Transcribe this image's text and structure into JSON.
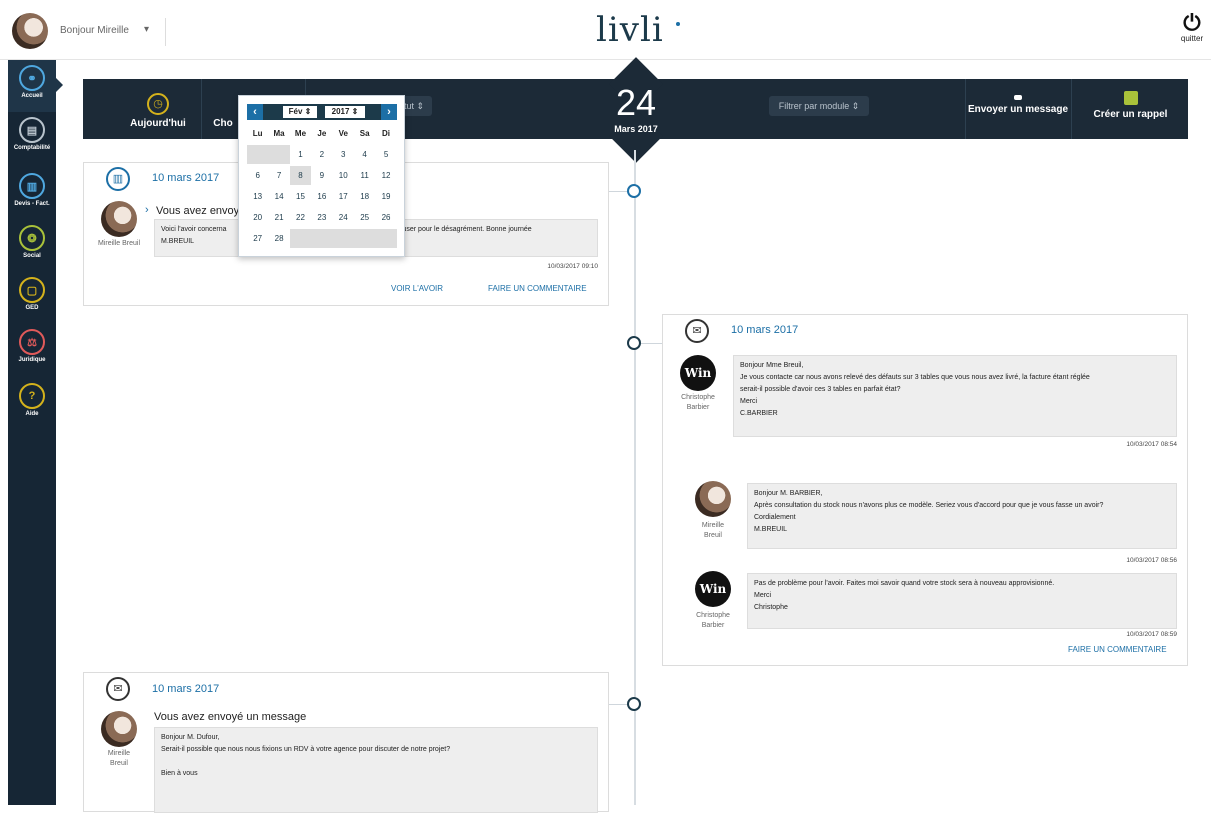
{
  "header": {
    "greeting": "Bonjour Mireille",
    "caret": "▾",
    "logo": "livli",
    "quit_icon": "⏻",
    "quit_label": "quitter"
  },
  "sidebar": {
    "items": [
      {
        "label": "Accueil",
        "icon": "home-network-icon",
        "glyph": "⚭",
        "color": "#4fa8e0",
        "active": true
      },
      {
        "label": "Comptabilité",
        "icon": "ledger-icon",
        "glyph": "▤",
        "color": "#b8c3cc"
      },
      {
        "label": "Devis - Fact.",
        "icon": "invoice-icon",
        "glyph": "▥",
        "color": "#4fa8e0"
      },
      {
        "label": "Social",
        "icon": "people-icon",
        "glyph": "❂",
        "color": "#a9c23a"
      },
      {
        "label": "GED",
        "icon": "documents-icon",
        "glyph": "▢",
        "color": "#d4b21c"
      },
      {
        "label": "Juridique",
        "icon": "legal-icon",
        "glyph": "⚖",
        "color": "#e05a5a"
      },
      {
        "label": "Aide",
        "icon": "help-icon",
        "glyph": "?",
        "color": "#d4b21c"
      }
    ]
  },
  "toolbar": {
    "today": "Aujourd'hui",
    "choose": "Cho",
    "status_filter": "tut ⇕",
    "module_filter": "Filtrer par module ⇕",
    "send_message": "Envoyer un message",
    "create_reminder": "Créer un rappel",
    "date_day": "24",
    "date_month": "Mars 2017"
  },
  "calendar": {
    "prev": "‹",
    "next": "›",
    "month": "Fév ⇕",
    "year": "2017 ⇕",
    "weekdays": [
      "Lu",
      "Ma",
      "Me",
      "Je",
      "Ve",
      "Sa",
      "Di"
    ],
    "weeks": [
      [
        "",
        "",
        "1",
        "2",
        "3",
        "4",
        "5"
      ],
      [
        "6",
        "7",
        "8",
        "9",
        "10",
        "11",
        "12"
      ],
      [
        "13",
        "14",
        "15",
        "16",
        "17",
        "18",
        "19"
      ],
      [
        "20",
        "21",
        "22",
        "23",
        "24",
        "25",
        "26"
      ],
      [
        "27",
        "28",
        "",
        "",
        "",
        "",
        ""
      ]
    ],
    "selected": "8"
  },
  "card1": {
    "date": "10 mars 2017",
    "title": "Vous avez envoyé",
    "author": "Mireille Breuil",
    "message_left": "Voici l'avoir concerna",
    "message_right": "cuser pour le désagrément. Bonne journée",
    "signature": "M.BREUIL",
    "time": "10/03/2017 09:10",
    "link_view": "VOIR L'AVOIR",
    "link_comment": "FAIRE UN COMMENTAIRE"
  },
  "card2": {
    "date": "10 mars 2017",
    "messages": [
      {
        "author_first": "Christophe",
        "author_last": "Barbier",
        "lines": [
          "Bonjour Mme Breuil,",
          "Je vous contacte car nous avons relevé des défauts sur 3 tables que vous nous avez livré, la facture étant réglée",
          "serait-il possible d'avoir ces 3 tables en parfait état?",
          "Merci",
          "C.BARBIER"
        ],
        "time": "10/03/2017 08:54"
      },
      {
        "author_first": "Mireille",
        "author_last": "Breuil",
        "lines": [
          "Bonjour M. BARBIER,",
          "Après consultation du stock nous n'avons plus ce modèle. Seriez vous d'accord pour que je vous fasse un avoir?",
          "Cordialement",
          "M.BREUIL"
        ],
        "time": "10/03/2017 08:56"
      },
      {
        "author_first": "Christophe",
        "author_last": "Barbier",
        "lines": [
          "Pas de problème pour l'avoir. Faites moi savoir quand votre stock sera à nouveau approvisionné.",
          "Merci",
          "Christophe"
        ],
        "time": "10/03/2017 08:59"
      }
    ],
    "win_text": "Win",
    "link_comment": "FAIRE UN COMMENTAIRE"
  },
  "card3": {
    "date": "10 mars 2017",
    "title": "Vous avez envoyé un message",
    "author_first": "Mireille",
    "author_last": "Breuil",
    "lines": [
      "Bonjour M. Dufour,",
      "Serait-il possible que nous nous fixions un RDV à votre agence pour discuter de notre projet?",
      "",
      "Bien à vous"
    ]
  }
}
